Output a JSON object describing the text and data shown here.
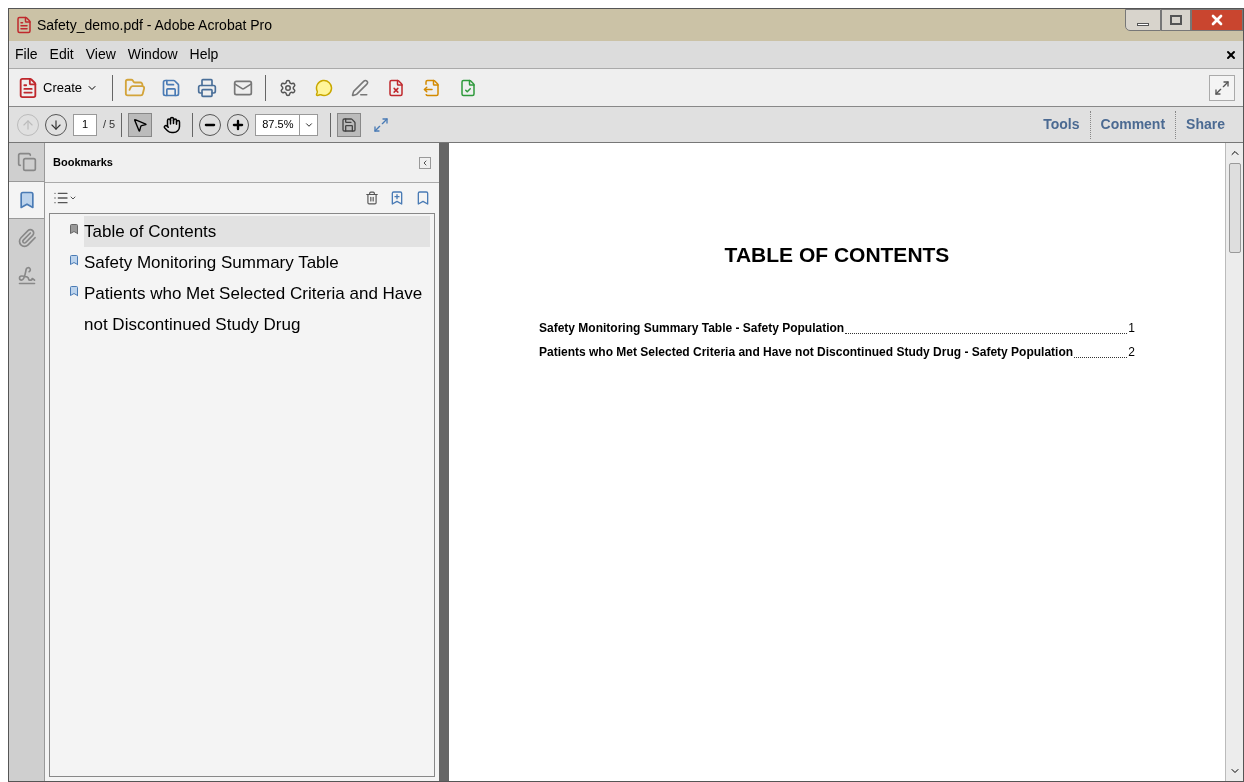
{
  "window": {
    "title": "Safety_demo.pdf - Adobe Acrobat Pro"
  },
  "menu": [
    "File",
    "Edit",
    "View",
    "Window",
    "Help"
  ],
  "toolbar": {
    "create_label": "Create"
  },
  "navigation": {
    "page": "1",
    "page_total": "/ 5",
    "zoom": "87.5%"
  },
  "task_tabs": [
    "Tools",
    "Comment",
    "Share"
  ],
  "nav_buttons": [
    {
      "kind": "pages",
      "selected": false
    },
    {
      "kind": "bookmarks",
      "selected": true
    },
    {
      "kind": "attachments",
      "selected": false
    },
    {
      "kind": "signatures",
      "selected": false
    }
  ],
  "bookmarks_panel": {
    "title": "Bookmarks",
    "items": [
      {
        "label": "Table of Contents",
        "selected": true
      },
      {
        "label": "Safety Monitoring Summary Table",
        "selected": false
      },
      {
        "label": "Patients who Met Selected Criteria and Have not Discontinued Study Drug",
        "selected": false
      }
    ]
  },
  "document": {
    "heading": "TABLE OF CONTENTS",
    "entries": [
      {
        "title": "Safety Monitoring Summary Table - Safety Population",
        "page": "1"
      },
      {
        "title": "Patients who Met Selected Criteria and Have not Discontinued Study Drug - Safety Population",
        "page": "2"
      }
    ]
  }
}
